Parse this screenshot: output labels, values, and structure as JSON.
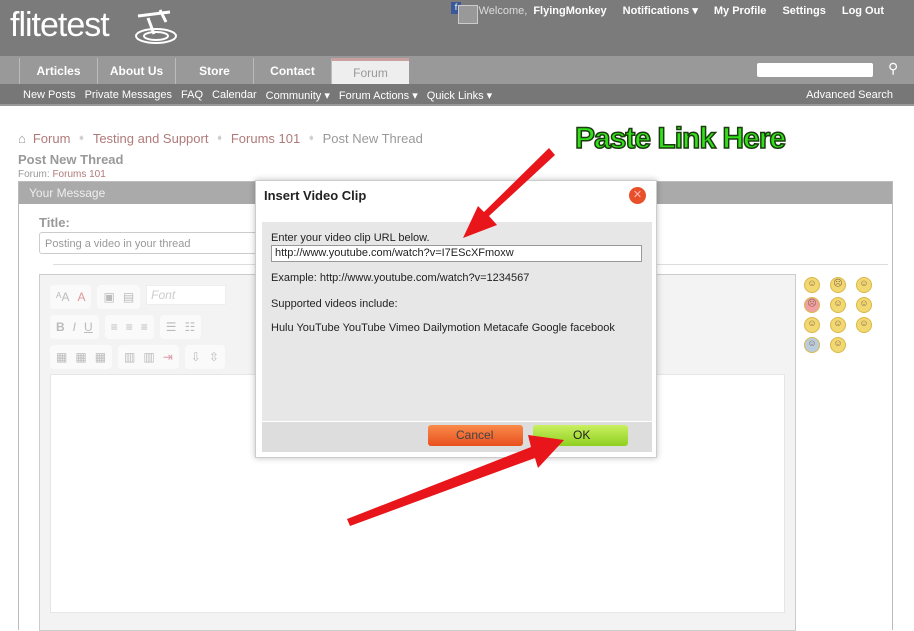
{
  "header": {
    "logo": "flitetest",
    "welcome": "Welcome,",
    "username": "FlyingMonkey",
    "links": [
      "Notifications ▾",
      "My Profile",
      "Settings",
      "Log Out"
    ]
  },
  "nav": {
    "tabs": [
      "Articles",
      "About Us",
      "Store",
      "Contact",
      "Forum"
    ],
    "active": "Forum"
  },
  "subnav": {
    "links": [
      "New Posts",
      "Private Messages",
      "FAQ",
      "Calendar",
      "Community ▾",
      "Forum Actions ▾",
      "Quick Links ▾"
    ],
    "advanced": "Advanced Search"
  },
  "breadcrumb": [
    "Forum",
    "Testing and Support",
    "Forums 101",
    "Post New Thread"
  ],
  "page": {
    "title": "Post New Thread",
    "forum_label": "Forum:",
    "forum_name": "Forums 101"
  },
  "panel": {
    "header": "Your Message",
    "title_label": "Title:",
    "title_value": "Posting a video in your thread",
    "font_placeholder": "Font"
  },
  "modal": {
    "title": "Insert Video Clip",
    "prompt": "Enter your video clip URL below.",
    "url": "http://www.youtube.com/watch?v=I7EScXFmoxw",
    "example": "Example: http://www.youtube.com/watch?v=1234567",
    "supported_label": "Supported videos include:",
    "supported": "Hulu YouTube YouTube Vimeo Dailymotion Metacafe Google facebook",
    "cancel": "Cancel",
    "ok": "OK"
  },
  "annotation": {
    "text": "Paste Link Here",
    "color": "#33e01a",
    "arrow_color": "#e8161a"
  }
}
